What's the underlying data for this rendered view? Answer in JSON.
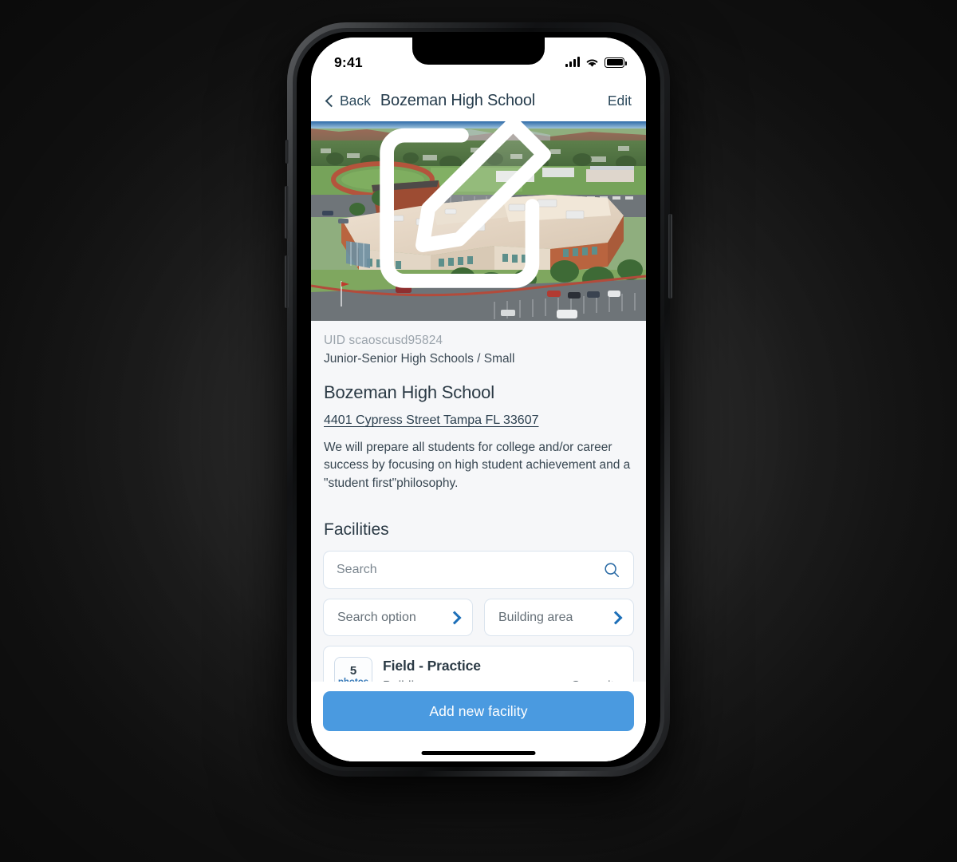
{
  "status_bar": {
    "time": "9:41",
    "signal_icon": "cellular-signal-icon",
    "wifi_icon": "wifi-icon",
    "battery_icon": "battery-full-icon"
  },
  "nav": {
    "back_label": "Back",
    "back_icon": "chevron-left-icon",
    "title": "Bozeman High School",
    "edit_label": "Edit"
  },
  "hero": {
    "alt": "Aerial photo of Bozeman High School campus",
    "edit_icon": "pencil-square-edit-icon"
  },
  "info": {
    "uid": "UID scaoscusd95824",
    "category": "Junior-Senior High Schools / Small",
    "school_name": "Bozeman High School",
    "address": "4401 Cypress Street Tampa FL 33607",
    "description": "We will prepare all students for college and/or career success by focusing on high student achievement and a \"student first\"philosophy."
  },
  "facilities": {
    "section_title": "Facilities",
    "search": {
      "placeholder": "Search",
      "value": "",
      "icon": "search-icon"
    },
    "filters": [
      {
        "label": "Search option",
        "icon": "chevron-right-icon"
      },
      {
        "label": "Building area",
        "icon": "chevron-right-icon"
      }
    ],
    "items": [
      {
        "photo_count": "5",
        "photo_unit": "photos",
        "name": "Field - Practice",
        "type_label": "Building",
        "capacity_label": "Capacity"
      }
    ]
  },
  "bottom": {
    "add_label": "Add new facility"
  },
  "colors": {
    "accent_blue": "#4a9ae0",
    "link_blue": "#1d6fb8",
    "text_dark": "#2b3a45",
    "muted": "#9aa3ab",
    "surface": "#f6f7f9",
    "border": "#dbe4ee"
  }
}
